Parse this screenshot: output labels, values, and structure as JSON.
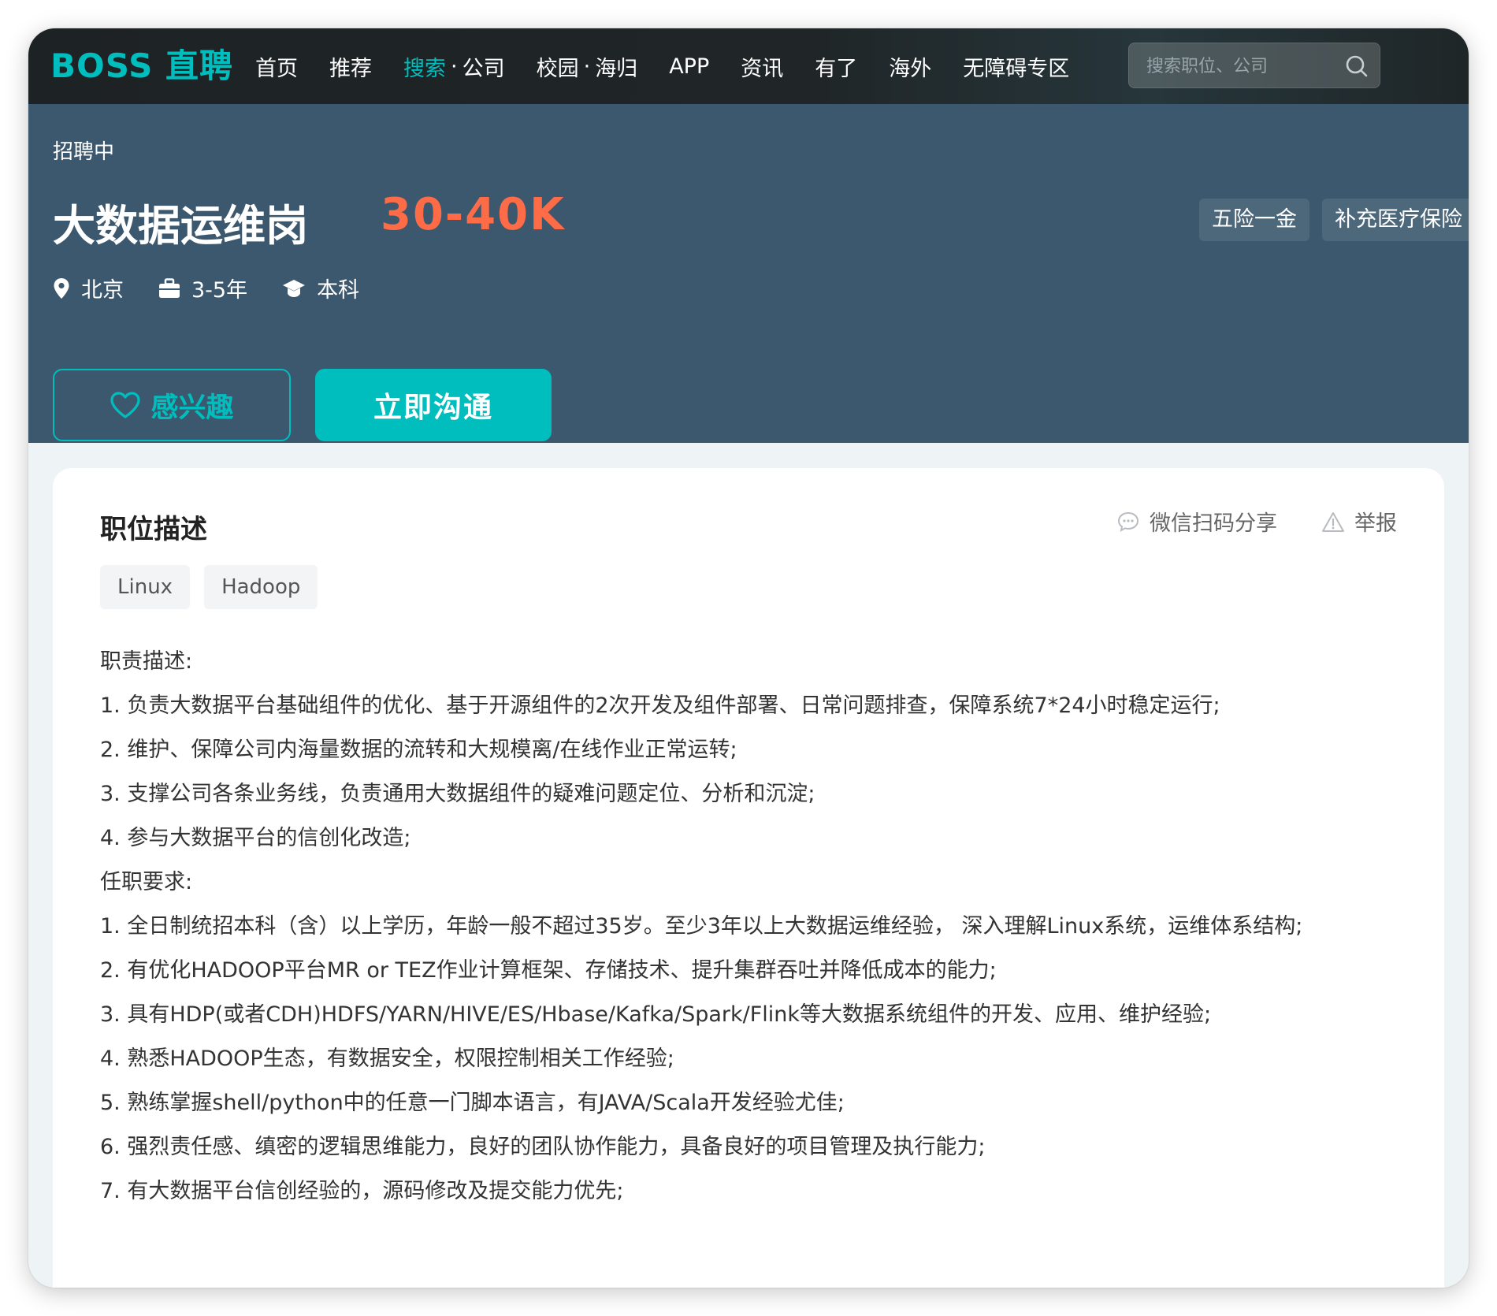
{
  "brand": {
    "logo": "BOSS 直聘"
  },
  "nav": {
    "home": "首页",
    "recommend": "推荐",
    "search_hl": "搜索",
    "search_company": "公司",
    "campus": "校园",
    "returnee": "海归",
    "app": "APP",
    "news": "资讯",
    "youle": "有了",
    "overseas": "海外",
    "accessible": "无障碍专区",
    "dot": "·"
  },
  "search": {
    "placeholder": "搜索职位、公司",
    "value": ""
  },
  "job": {
    "status": "招聘中",
    "title": "大数据运维岗",
    "salary": "30-40K",
    "welfare": [
      "五险一金",
      "补充医疗保险"
    ],
    "city": "北京",
    "experience": "3-5年",
    "education": "本科",
    "interest_label": "感兴趣",
    "chat_label": "立即沟通"
  },
  "section": {
    "title": "职位描述",
    "share_label": "微信扫码分享",
    "report_label": "举报",
    "skills": [
      "Linux",
      "Hadoop"
    ],
    "lines": [
      "职责描述:",
      "1. 负责大数据平台基础组件的优化、基于开源组件的2次开发及组件部署、日常问题排查，保障系统7*24小时稳定运行;",
      "2. 维护、保障公司内海量数据的流转和大规模离/在线作业正常运转;",
      "3. 支撑公司各条业务线，负责通用大数据组件的疑难问题定位、分析和沉淀;",
      "4. 参与大数据平台的信创化改造;",
      "任职要求:",
      "1. 全日制统招本科（含）以上学历，年龄一般不超过35岁。至少3年以上大数据运维经验， 深入理解Linux系统，运维体系结构;",
      "2. 有优化HADOOP平台MR or TEZ作业计算框架、存储技术、提升集群吞吐并降低成本的能力;",
      "3. 具有HDP(或者CDH)HDFS/YARN/HIVE/ES/Hbase/Kafka/Spark/Flink等大数据系统组件的开发、应用、维护经验;",
      "4. 熟悉HADOOP生态，有数据安全，权限控制相关工作经验;",
      "5. 熟练掌握shell/python中的任意一门脚本语言，有JAVA/Scala开发经验尤佳;",
      "6. 强烈责任感、缜密的逻辑思维能力，良好的团队协作能力，具备良好的项目管理及执行能力;",
      "7. 有大数据平台信创经验的，源码修改及提交能力优先;"
    ]
  },
  "colors": {
    "brand_teal": "#00bebd",
    "salary_orange": "#fe6b47",
    "banner_bg": "#3c586e",
    "nav_bg": "#202628"
  },
  "icons": {
    "search": "search-icon",
    "location": "location-pin-icon",
    "experience": "briefcase-icon",
    "education": "graduation-cap-icon",
    "interest": "heart-icon",
    "share": "chat-bubble-icon",
    "report": "warning-triangle-icon"
  }
}
